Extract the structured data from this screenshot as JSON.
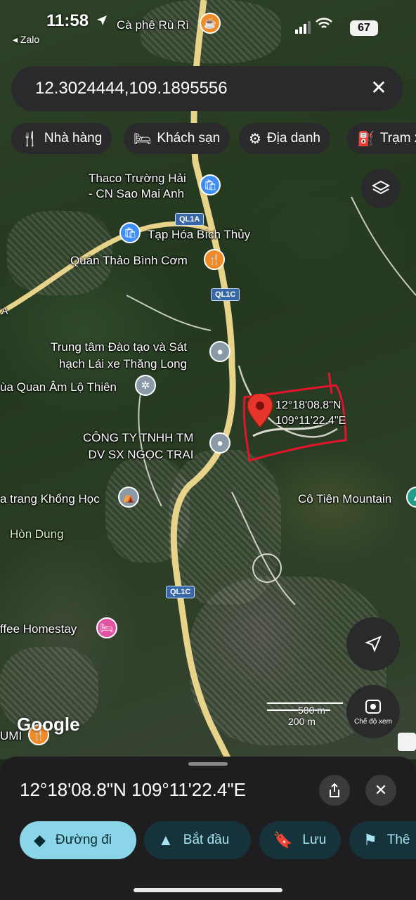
{
  "status_bar": {
    "time": "11:58",
    "back_app": "◂ Zalo",
    "battery": "67"
  },
  "search": {
    "query": "12.3024444,109.1895556"
  },
  "chips": [
    {
      "icon": "restaurant-icon",
      "label": "Nhà hàng"
    },
    {
      "icon": "hotel-icon",
      "label": "Khách sạn"
    },
    {
      "icon": "landmark-icon",
      "label": "Địa danh"
    },
    {
      "icon": "gas-station-icon",
      "label": "Trạm x"
    }
  ],
  "map": {
    "pois": [
      {
        "label": "Cà phê Rù Rì",
        "type": "cafe"
      },
      {
        "label": "Thaco Trường Hải\n- CN Sao Mai Anh",
        "type": "shopping"
      },
      {
        "label": "Tạp Hóa Bích Thủy",
        "type": "shopping"
      },
      {
        "label": "Quán Thảo Bình Cơm",
        "type": "restaurant"
      },
      {
        "label": "Trung tâm Đào tạo và Sát\nhạch Lái xe Thăng Long",
        "type": "place"
      },
      {
        "label": "ùa Quan Âm Lộ Thiên",
        "type": "temple"
      },
      {
        "label": "CÔNG TY TNHH TM\nDV SX NGỌC TRAI",
        "type": "place"
      },
      {
        "label": "a trang Khổng Học",
        "type": "landmark"
      },
      {
        "label": "Hòn Dung",
        "type": "area"
      },
      {
        "label": "Cô Tiên Mountain",
        "type": "mountain"
      },
      {
        "label": "ffee Homestay",
        "type": "hotel"
      },
      {
        "label": "UMI",
        "type": "place"
      }
    ],
    "road_shields": [
      "QL1A",
      "QL1C",
      "QL1C"
    ],
    "road_label_left": "A",
    "pin_label": "12°18'08.8\"N\n109°11'22.4\"E",
    "scale": {
      "top": "500 m",
      "bottom": "200 m"
    },
    "google_logo": "Google",
    "view_mode_label": "Chế độ xem",
    "colors": {
      "marker": "#e8352b",
      "annotation": "#e3142c"
    }
  },
  "sheet": {
    "coordinates": "12°18'08.8\"N 109°11'22.4\"E",
    "actions": [
      {
        "icon": "directions-icon",
        "label": "Đường đi",
        "primary": true
      },
      {
        "icon": "navigate-icon",
        "label": "Bắt đầu",
        "primary": false
      },
      {
        "icon": "bookmark-icon",
        "label": "Lưu",
        "primary": false
      },
      {
        "icon": "flag-icon",
        "label": "Thê",
        "primary": false
      }
    ]
  }
}
